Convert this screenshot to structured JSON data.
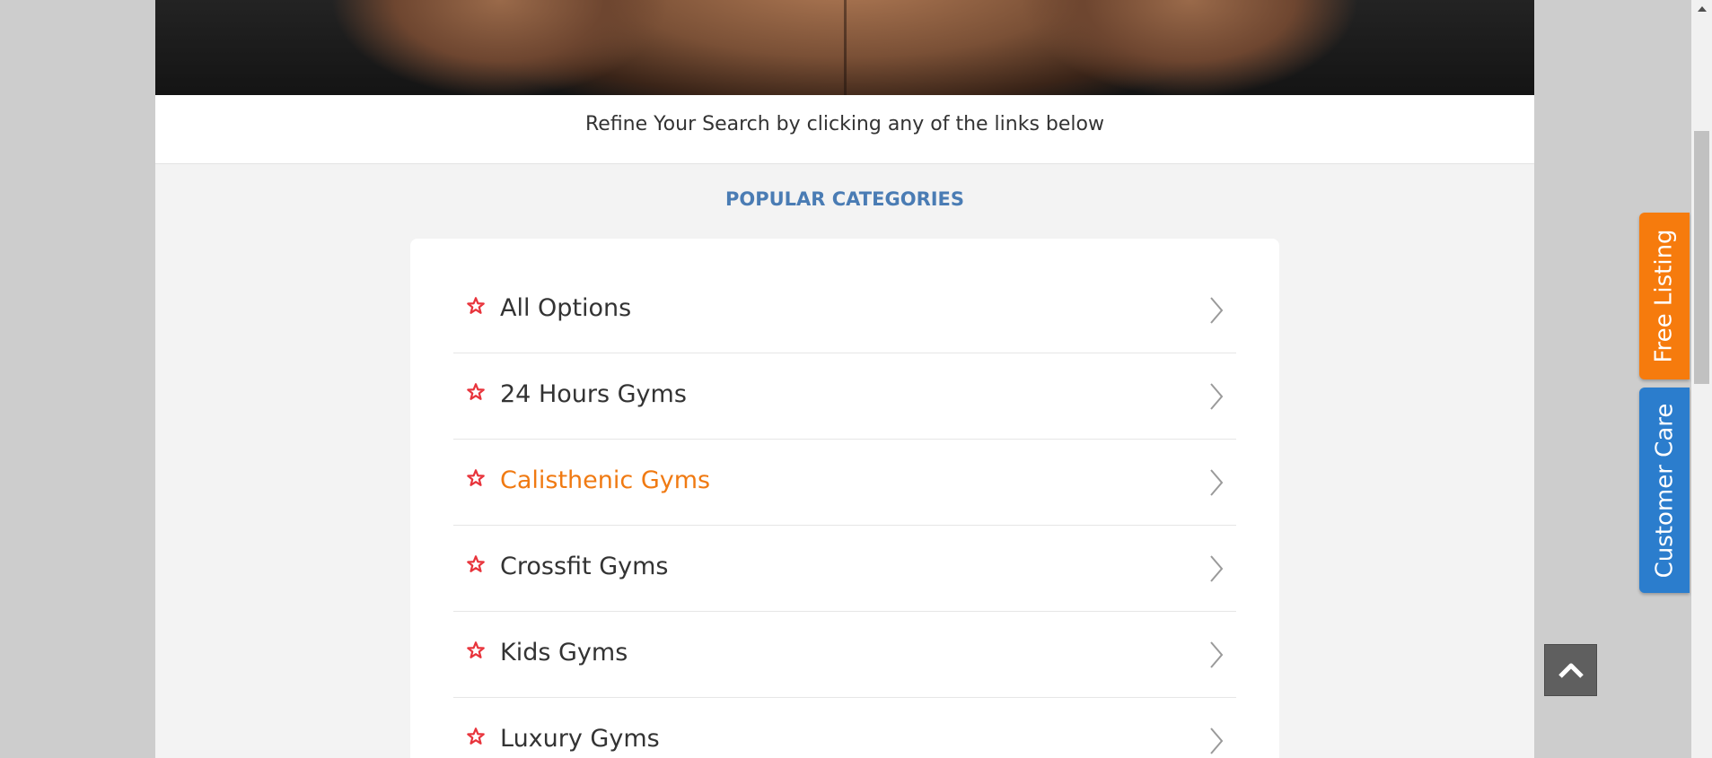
{
  "refine": {
    "text": "Refine Your Search by clicking any of the links below"
  },
  "popular": {
    "title": "POPULAR CATEGORIES",
    "items": [
      {
        "label": "All Options"
      },
      {
        "label": "24 Hours Gyms"
      },
      {
        "label": "Calisthenic Gyms"
      },
      {
        "label": "Crossfit Gyms"
      },
      {
        "label": "Kids Gyms"
      },
      {
        "label": "Luxury Gyms"
      }
    ],
    "active_item": "Calisthenic Gyms",
    "icons": {
      "item_icon": "star-outline-icon",
      "chevron": "chevron-right-icon"
    }
  },
  "side_tabs": {
    "free_listing": "Free Listing",
    "customer_care": "Customer Care"
  },
  "colors": {
    "accent_orange": "#f67b0d",
    "accent_blue": "#2b7dcd",
    "title_blue": "#4a7cb4",
    "star_red": "#e8333b"
  }
}
